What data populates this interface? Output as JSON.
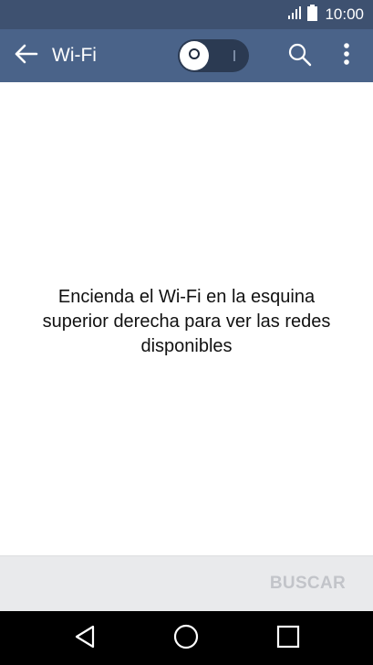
{
  "status_bar": {
    "time": "10:00",
    "icons": [
      "signal-icon",
      "battery-icon"
    ]
  },
  "app_bar": {
    "title": "Wi-Fi",
    "icons": [
      "back-arrow-icon",
      "toggle-switch",
      "search-icon",
      "more-vert-icon"
    ],
    "wifi_toggle_state": "off"
  },
  "content": {
    "empty_message": "Encienda el Wi-Fi en la esquina superior derecha para ver las redes disponibles"
  },
  "bottom_bar": {
    "scan_label": "BUSCAR"
  },
  "nav_bar": {
    "icons": [
      "back-triangle-icon",
      "home-circle-icon",
      "recents-square-icon"
    ]
  },
  "colors": {
    "status_bar_bg": "#3e5170",
    "app_bar_bg": "#4a6389",
    "toggle_track": "#2b3a52",
    "bottom_bar_bg": "#e9eaec",
    "scan_label_disabled": "#c2c4c9",
    "nav_bar_bg": "#000000"
  }
}
